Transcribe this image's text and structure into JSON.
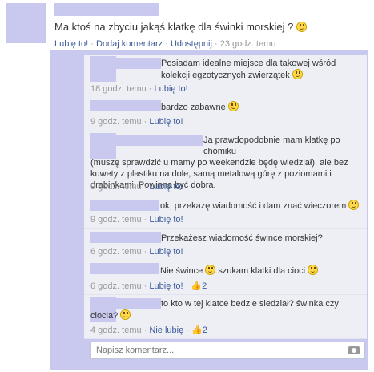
{
  "post": {
    "text": "Ma ktoś na zbyciu jakąś klatkę dla świnki morskiej ?",
    "like": "Lubię to!",
    "comment": "Dodaj komentarz",
    "share": "Udostępnij",
    "time": "23 godz. temu"
  },
  "comments": [
    {
      "text": "Posiadam idealne miejsce dla takowej wśród kolekcji egzotycznych zwierzątek",
      "time": "18 godz. temu",
      "like": "Lubię to!"
    },
    {
      "text": "bardzo zabawne",
      "time": "9 godz. temu",
      "like": "Lubię to!"
    },
    {
      "text_line1": "Ja prawdopodobnie mam klatkę po chomiku",
      "text_rest": "(muszę sprawdzić u mamy po weekendzie będę wiedział), ale bez kuwety z plastiku na dole, samą metalową górę z poziomami i drabinkami. Powinna być dobra.",
      "time": "9 godz. temu",
      "like": "Lubię to!"
    },
    {
      "text": "ok, przekażę wiadomość i dam znać wieczorem",
      "time": "9 godz. temu",
      "like": "Lubię to!"
    },
    {
      "text": "Przekażesz wiadomość śwince morskiej?",
      "time": "6 godz. temu",
      "like": "Lubię to!"
    },
    {
      "text_a": "Nie śwince",
      "text_b": "szukam klatki dla cioci",
      "time": "6 godz. temu",
      "like": "Lubię to!",
      "likes_count": "2"
    },
    {
      "text_line1": "to kto w tej klatce bedzie siedział? świnka czy",
      "text_line2": "ciocia?",
      "time": "4 godz. temu",
      "unlike": "Nie lubię",
      "likes_count": "2"
    }
  ],
  "composer": {
    "placeholder": "Napisz komentarz..."
  },
  "icons": [
    "smiley-icon",
    "thumbs-up-icon",
    "camera-icon"
  ]
}
